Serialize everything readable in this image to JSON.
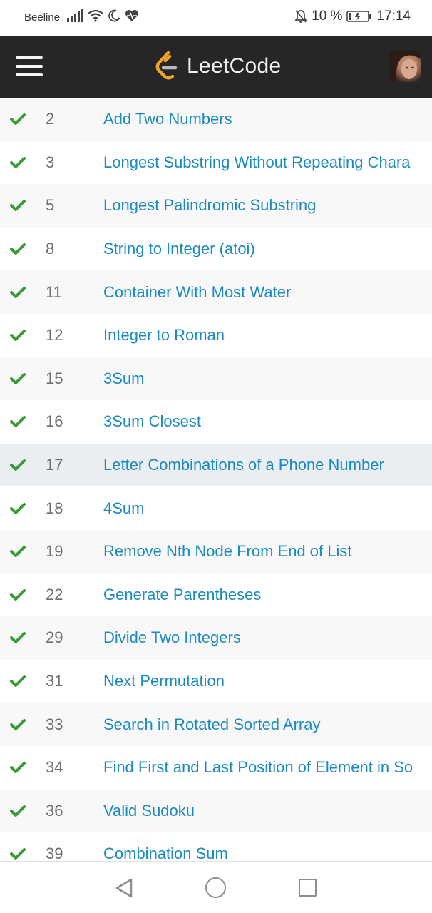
{
  "status_bar": {
    "carrier": "Beeline",
    "battery": "10 %",
    "time": "17:14"
  },
  "header": {
    "logo_text": "LeetCode",
    "menu_icon": "hamburger-menu-icon",
    "avatar_icon": "user-avatar"
  },
  "colors": {
    "header_bg": "#262626",
    "link": "#1a8bc0",
    "check": "#3a9a3a",
    "logo_orange": "#f0a22a"
  },
  "problems": [
    {
      "num": "2",
      "title": "Add Two Numbers",
      "solved": true
    },
    {
      "num": "3",
      "title": "Longest Substring Without Repeating Chara",
      "solved": true
    },
    {
      "num": "5",
      "title": "Longest Palindromic Substring",
      "solved": true
    },
    {
      "num": "8",
      "title": "String to Integer (atoi)",
      "solved": true
    },
    {
      "num": "11",
      "title": "Container With Most Water",
      "solved": true
    },
    {
      "num": "12",
      "title": "Integer to Roman",
      "solved": true
    },
    {
      "num": "15",
      "title": "3Sum",
      "solved": true
    },
    {
      "num": "16",
      "title": "3Sum Closest",
      "solved": true
    },
    {
      "num": "17",
      "title": "Letter Combinations of a Phone Number",
      "solved": true,
      "highlighted": true
    },
    {
      "num": "18",
      "title": "4Sum",
      "solved": true
    },
    {
      "num": "19",
      "title": "Remove Nth Node From End of List",
      "solved": true
    },
    {
      "num": "22",
      "title": "Generate Parentheses",
      "solved": true
    },
    {
      "num": "29",
      "title": "Divide Two Integers",
      "solved": true
    },
    {
      "num": "31",
      "title": "Next Permutation",
      "solved": true
    },
    {
      "num": "33",
      "title": "Search in Rotated Sorted Array",
      "solved": true
    },
    {
      "num": "34",
      "title": "Find First and Last Position of Element in So",
      "solved": true
    },
    {
      "num": "36",
      "title": "Valid Sudoku",
      "solved": true
    },
    {
      "num": "39",
      "title": "Combination Sum",
      "solved": true
    }
  ]
}
